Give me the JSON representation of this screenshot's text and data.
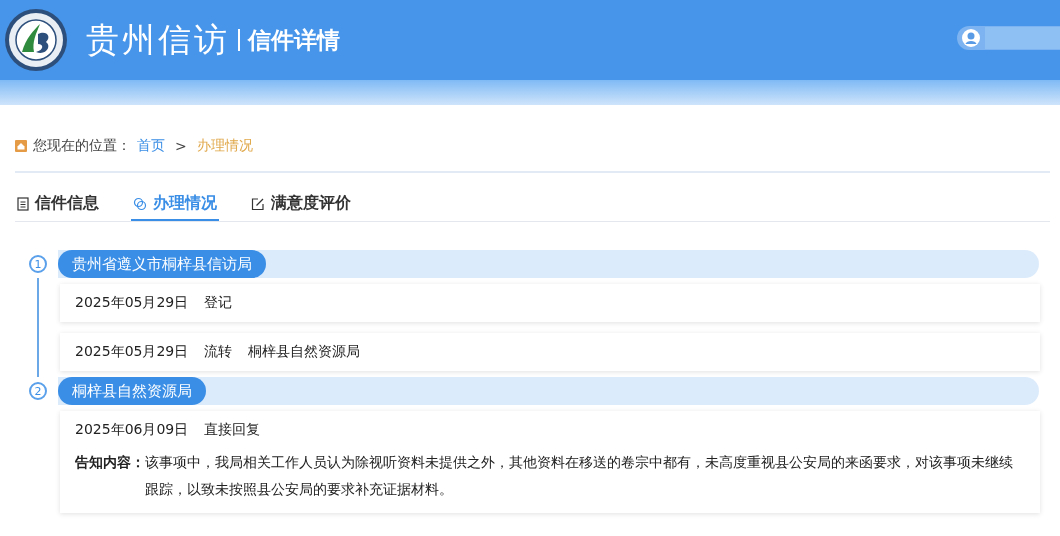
{
  "header": {
    "site_title": "贵州信访",
    "page_title": "信件详情"
  },
  "breadcrumb": {
    "label": "您现在的位置：",
    "items": [
      {
        "text": "首页",
        "current": false
      },
      {
        "text": "办理情况",
        "current": true
      }
    ],
    "separator": ">"
  },
  "tabs": [
    {
      "label": "信件信息",
      "kind": "document",
      "selected": false
    },
    {
      "label": "办理情况",
      "kind": "chat",
      "selected": true
    },
    {
      "label": "满意度评价",
      "kind": "edit",
      "selected": false
    }
  ],
  "steps": [
    {
      "number": "1",
      "org": "贵州省遵义市桐梓县信访局",
      "entries": [
        {
          "date": "2025年05月29日",
          "action": "登记"
        },
        {
          "date": "2025年05月29日",
          "action": "流转",
          "target": "桐梓县自然资源局"
        }
      ]
    },
    {
      "number": "2",
      "org": "桐梓县自然资源局",
      "entries": [
        {
          "date": "2025年06月09日",
          "action": "直接回复",
          "notice_label": "告知内容：",
          "notice": "该事项中，我局相关工作人员认为除视听资料未提供之外，其他资料在移送的卷宗中都有，未高度重视县公安局的来函要求，对该事项未继续跟踪，以致未按照县公安局的要求补充证据材料。"
        }
      ]
    }
  ]
}
